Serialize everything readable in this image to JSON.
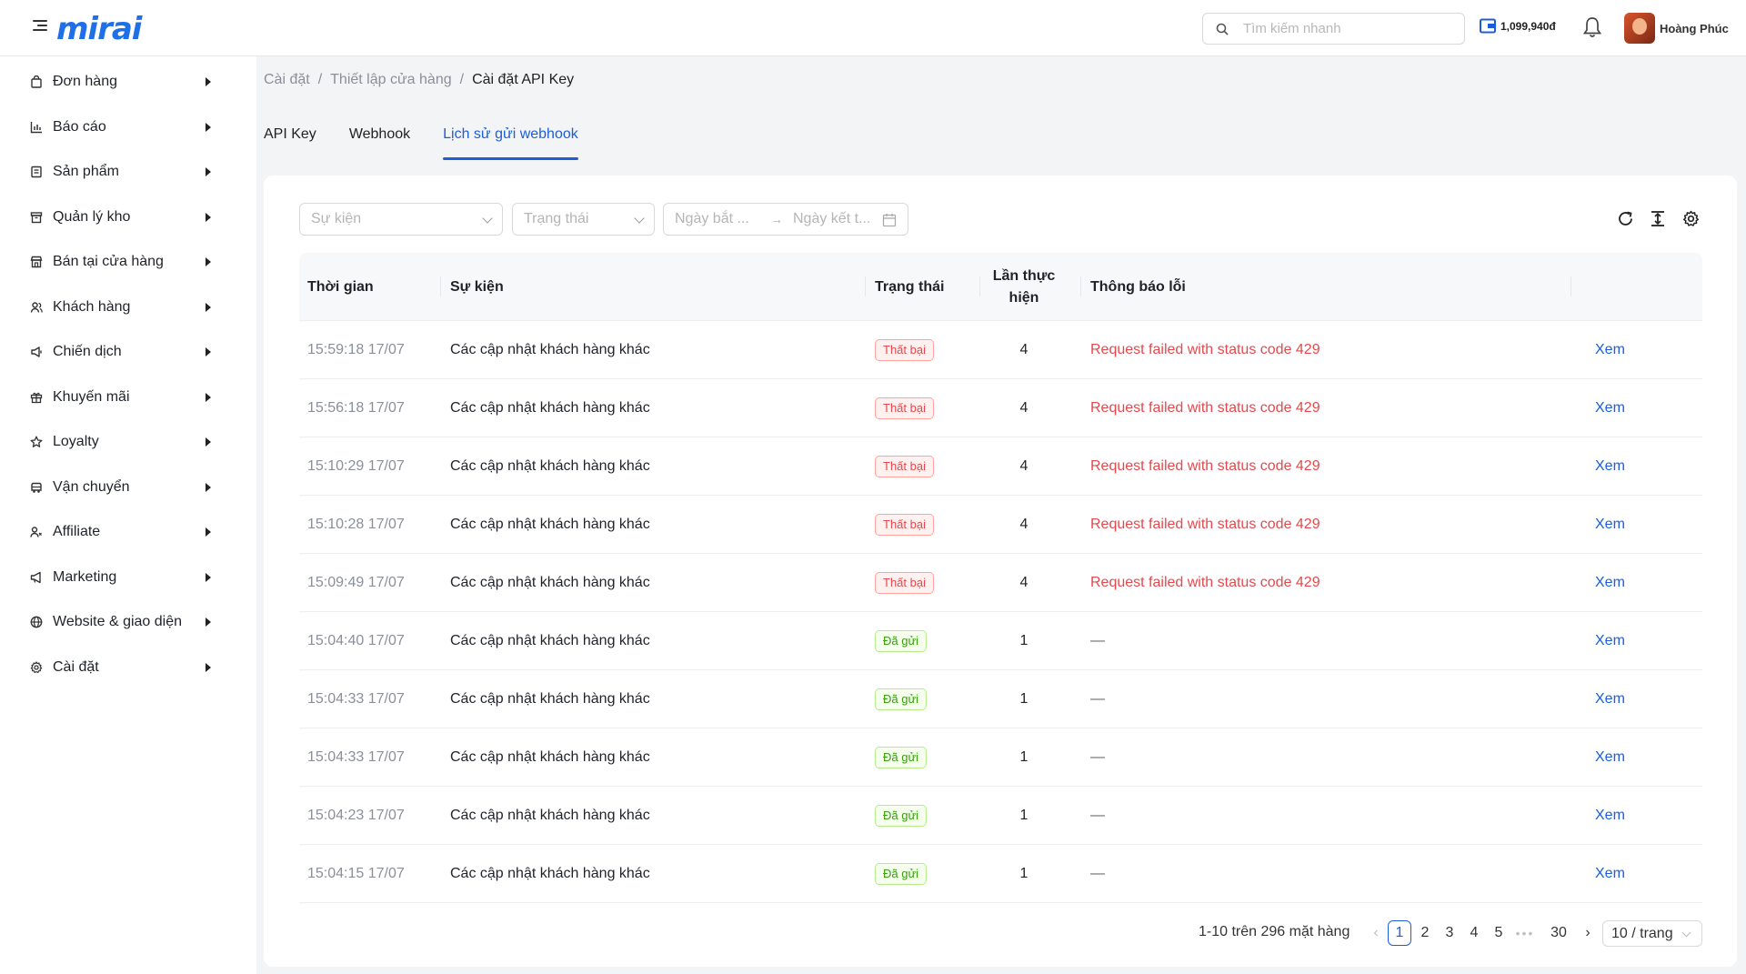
{
  "app": {
    "logo_text": "mirai",
    "search_placeholder": "Tìm kiếm nhanh",
    "wallet_balance": "1,099,940đ",
    "user_name": "Hoàng Phúc"
  },
  "sidebar": {
    "items": [
      {
        "label": "Đơn hàng",
        "icon": "shopping-bag-icon"
      },
      {
        "label": "Báo cáo",
        "icon": "bar-chart-icon"
      },
      {
        "label": "Sản phẩm",
        "icon": "product-list-icon"
      },
      {
        "label": "Quản lý kho",
        "icon": "warehouse-box-icon"
      },
      {
        "label": "Bán tại cửa hàng",
        "icon": "store-icon"
      },
      {
        "label": "Khách hàng",
        "icon": "users-icon"
      },
      {
        "label": "Chiến dịch",
        "icon": "megaphone-icon"
      },
      {
        "label": "Khuyến mãi",
        "icon": "gift-icon"
      },
      {
        "label": "Loyalty",
        "icon": "star-icon"
      },
      {
        "label": "Vận chuyển",
        "icon": "truck-icon"
      },
      {
        "label": "Affiliate",
        "icon": "affiliate-users-icon"
      },
      {
        "label": "Marketing",
        "icon": "marketing-megaphone-icon"
      },
      {
        "label": "Website & giao diện",
        "icon": "globe-icon"
      },
      {
        "label": "Cài đặt",
        "icon": "gear-icon"
      }
    ]
  },
  "breadcrumb": {
    "items": [
      "Cài đặt",
      "Thiết lập cửa hàng",
      "Cài đặt API Key"
    ],
    "separator": "/"
  },
  "tabs": [
    {
      "label": "API Key",
      "active": false
    },
    {
      "label": "Webhook",
      "active": false
    },
    {
      "label": "Lịch sử gửi webhook",
      "active": true
    }
  ],
  "filters": {
    "event_placeholder": "Sự kiện",
    "status_placeholder": "Trạng thái",
    "start_date_placeholder": "Ngày bắt ...",
    "end_date_placeholder": "Ngày kết t..."
  },
  "table": {
    "headers": {
      "time": "Thời gian",
      "event": "Sự kiện",
      "status": "Trạng thái",
      "attempts_line1": "Lần thực",
      "attempts_line2": "hiện",
      "error": "Thông báo lỗi"
    },
    "view_label": "Xem",
    "rows": [
      {
        "time": "15:59:18 17/07",
        "event": "Các cập nhật khách hàng khác",
        "status": "Thất bại",
        "status_type": "fail",
        "attempts": "4",
        "error": "Request failed with status code 429"
      },
      {
        "time": "15:56:18 17/07",
        "event": "Các cập nhật khách hàng khác",
        "status": "Thất bại",
        "status_type": "fail",
        "attempts": "4",
        "error": "Request failed with status code 429"
      },
      {
        "time": "15:10:29 17/07",
        "event": "Các cập nhật khách hàng khác",
        "status": "Thất bại",
        "status_type": "fail",
        "attempts": "4",
        "error": "Request failed with status code 429"
      },
      {
        "time": "15:10:28 17/07",
        "event": "Các cập nhật khách hàng khác",
        "status": "Thất bại",
        "status_type": "fail",
        "attempts": "4",
        "error": "Request failed with status code 429"
      },
      {
        "time": "15:09:49 17/07",
        "event": "Các cập nhật khách hàng khác",
        "status": "Thất bại",
        "status_type": "fail",
        "attempts": "4",
        "error": "Request failed with status code 429"
      },
      {
        "time": "15:04:40 17/07",
        "event": "Các cập nhật khách hàng khác",
        "status": "Đã gửi",
        "status_type": "ok",
        "attempts": "1",
        "error": "—"
      },
      {
        "time": "15:04:33 17/07",
        "event": "Các cập nhật khách hàng khác",
        "status": "Đã gửi",
        "status_type": "ok",
        "attempts": "1",
        "error": "—"
      },
      {
        "time": "15:04:33 17/07",
        "event": "Các cập nhật khách hàng khác",
        "status": "Đã gửi",
        "status_type": "ok",
        "attempts": "1",
        "error": "—"
      },
      {
        "time": "15:04:23 17/07",
        "event": "Các cập nhật khách hàng khác",
        "status": "Đã gửi",
        "status_type": "ok",
        "attempts": "1",
        "error": "—"
      },
      {
        "time": "15:04:15 17/07",
        "event": "Các cập nhật khách hàng khác",
        "status": "Đã gửi",
        "status_type": "ok",
        "attempts": "1",
        "error": "—"
      }
    ]
  },
  "pagination": {
    "summary": "1-10 trên 296 mặt hàng",
    "pages": [
      "1",
      "2",
      "3",
      "4",
      "5"
    ],
    "ellipsis": "•••",
    "last_page": "30",
    "current_page": "1",
    "page_size": "10 / trang"
  },
  "colors": {
    "accent": "#1d5ed8",
    "error": "#e5484d",
    "success": "#389e0d"
  }
}
